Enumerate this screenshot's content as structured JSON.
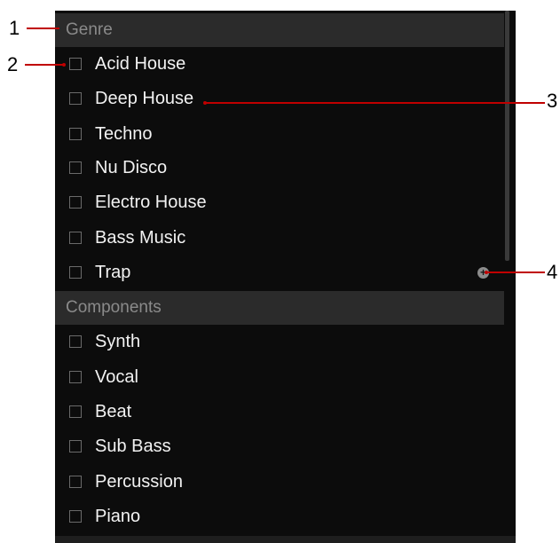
{
  "sections": [
    {
      "header": "Genre",
      "items": [
        "Acid House",
        "Deep House",
        "Techno",
        "Nu Disco",
        "Electro House",
        "Bass Music",
        "Trap"
      ]
    },
    {
      "header": "Components",
      "items": [
        "Synth",
        "Vocal",
        "Beat",
        "Sub Bass",
        "Percussion",
        "Piano"
      ]
    }
  ],
  "add_icon": {
    "glyph": "+",
    "icon": "plus-circle-icon"
  },
  "callouts": [
    "1",
    "2",
    "3",
    "4"
  ],
  "colors": {
    "panel": "#0c0c0c",
    "header": "#2b2b2b",
    "callout": "#c00000"
  }
}
